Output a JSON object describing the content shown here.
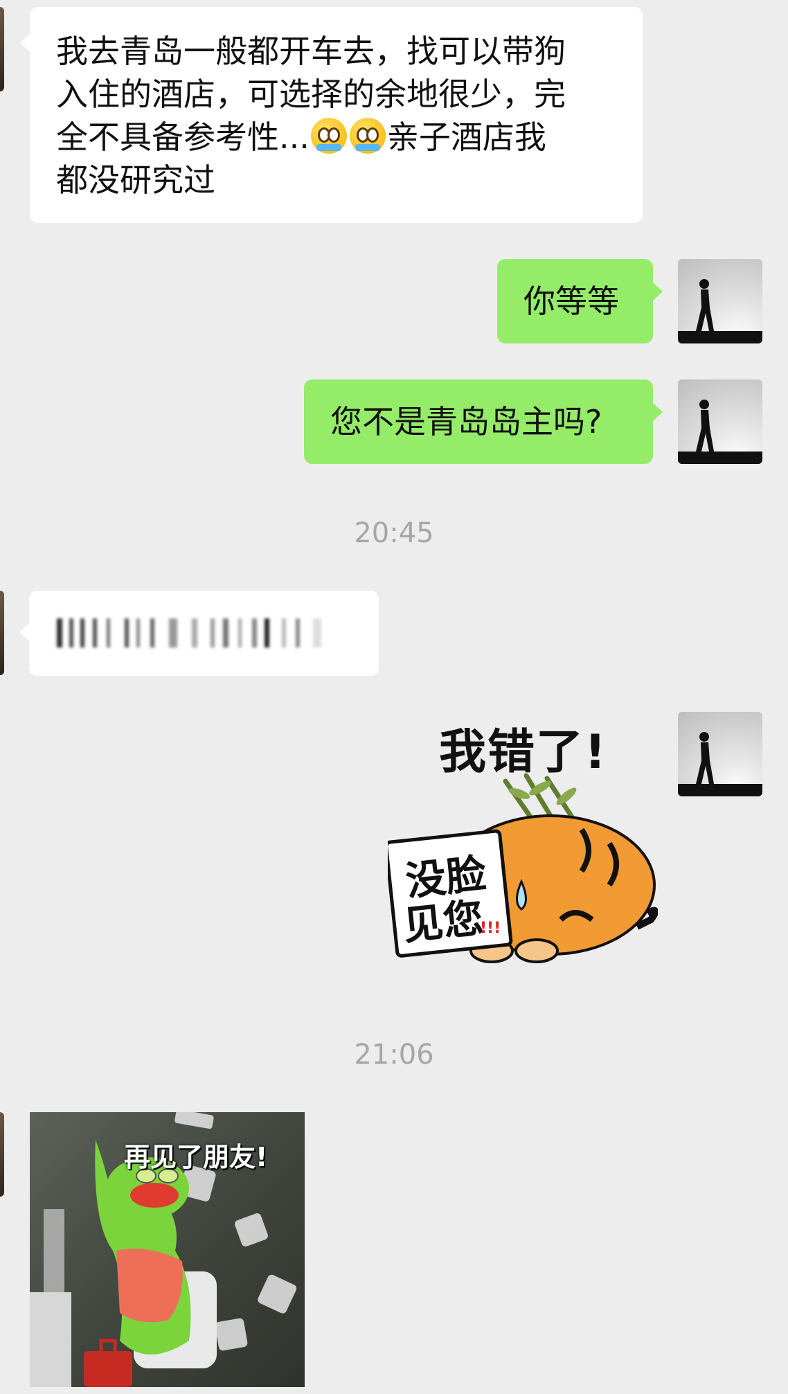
{
  "messages": [
    {
      "side": "in",
      "text_line1": "我去青岛一般都开车去，找可以带狗",
      "text_line2": "入住的酒店，可选择的余地很少，完",
      "text_line3a": "全不具备参考性...",
      "text_line3b": "亲子酒店我",
      "text_line4": "都没研究过",
      "emoji": "crying-face-icon"
    },
    {
      "side": "out",
      "text": "你等等"
    },
    {
      "side": "out",
      "text": "您不是青岛岛主吗?"
    },
    {
      "side": "in",
      "type": "blurred-text"
    },
    {
      "side": "out",
      "type": "sticker",
      "title": "我错了!",
      "sign_text_line1": "没脸",
      "sign_text_line2": "见您",
      "marks": "!!!"
    },
    {
      "side": "in",
      "type": "sticker",
      "caption": "再见了朋友!"
    }
  ],
  "timestamps": [
    "20:45",
    "21:06"
  ],
  "colors": {
    "background": "#ededed",
    "incoming": "#ffffff",
    "outgoing": "#95ec69",
    "timestamp": "#a6a6a6"
  }
}
